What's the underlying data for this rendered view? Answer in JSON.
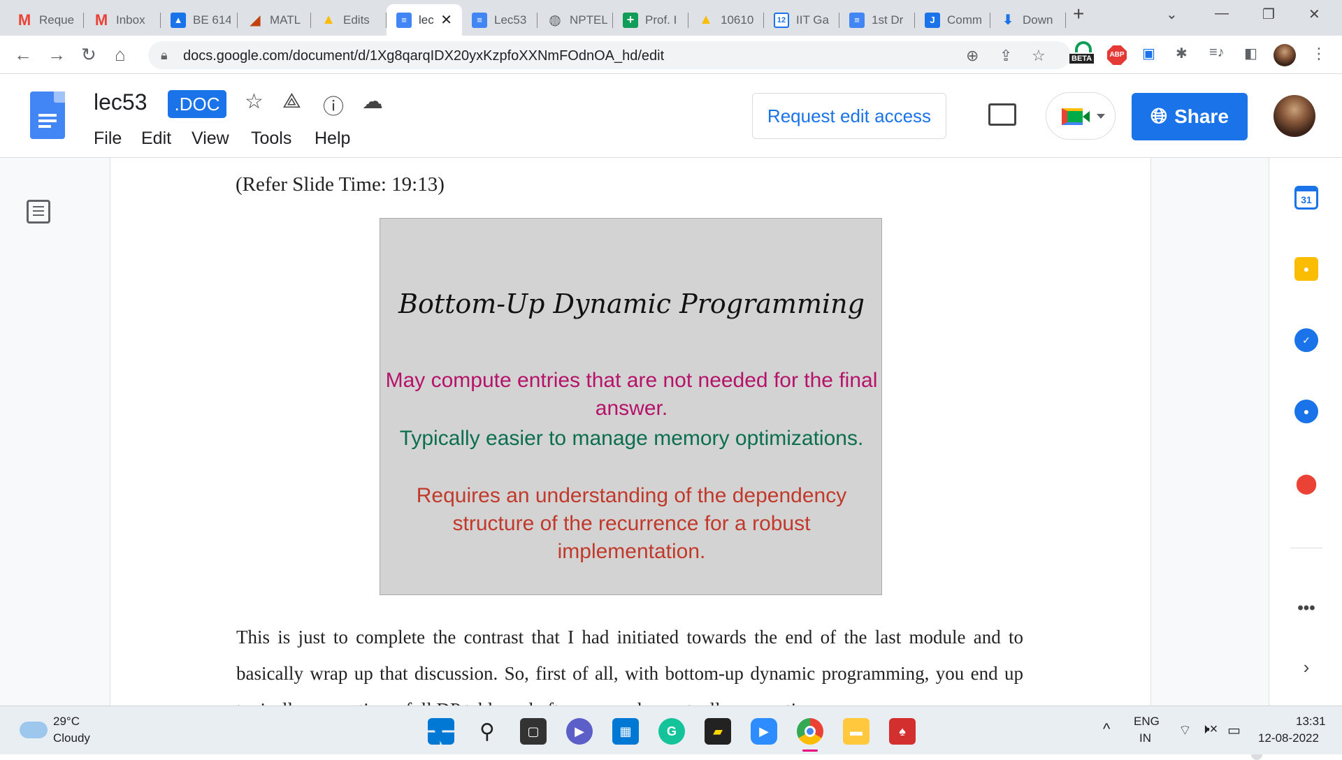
{
  "browser": {
    "tabs": [
      {
        "label": "Reque",
        "icon": "gmail-icon",
        "color": "#ea4335"
      },
      {
        "label": "Inbox",
        "icon": "gmail-icon",
        "color": "#ea4335"
      },
      {
        "label": "BE 614",
        "icon": "contacts-icon",
        "color": "#1a73e8"
      },
      {
        "label": "MATL",
        "icon": "matlab-icon",
        "color": "#c2410c"
      },
      {
        "label": "Edits",
        "icon": "drive-icon",
        "color": "#fbbc04"
      },
      {
        "label": "lec",
        "icon": "docs-icon",
        "color": "#4285f4",
        "active": true
      },
      {
        "label": "Lec53",
        "icon": "docs-icon",
        "color": "#4285f4"
      },
      {
        "label": "NPTEL",
        "icon": "globe-icon",
        "color": "#5f6368"
      },
      {
        "label": "Prof. I",
        "icon": "plus-sheet-icon",
        "color": "#0f9d58"
      },
      {
        "label": "10610",
        "icon": "drive-icon",
        "color": "#fbbc04"
      },
      {
        "label": "IIT Ga",
        "icon": "calendar-icon",
        "color": "#1a73e8"
      },
      {
        "label": "1st Dr",
        "icon": "docs-icon",
        "color": "#4285f4"
      },
      {
        "label": "Comm",
        "icon": "jamboard-icon",
        "color": "#1a73e8"
      },
      {
        "label": "Down",
        "icon": "download-icon",
        "color": "#1a73e8"
      }
    ],
    "url": "docs.google.com/document/d/1Xg8qarqIDX20yxKzpfoXXNmFOdnOA_hd/edit",
    "ext_beta": "BETA",
    "ext_abp": "ABP"
  },
  "doc": {
    "title": "lec53",
    "badge": ".DOC",
    "menu": [
      "File",
      "Edit",
      "View",
      "Tools",
      "Help"
    ],
    "request_access": "Request edit access",
    "share": "Share",
    "refer": "(Refer Slide Time: 19:13)",
    "slide": {
      "title": "Bottom-Up Dynamic Programming",
      "lines": [
        {
          "text": "May compute entries that are not needed for the final answer.",
          "color": "#b5126a"
        },
        {
          "text": "Typically easier to manage memory optimizations.",
          "color": "#0b6e4f"
        },
        {
          "text": "Requires an understanding of the dependency structure of the recurrence for a robust implementation.",
          "color": "#c0392b"
        }
      ]
    },
    "paragraph": "This is just to complete the contrast that I had initiated towards the end of the last module and to basically wrap up that discussion. So, first of all, with bottom-up dynamic programming, you end up typically computing a full DP table and often you end up actually computing"
  },
  "sidepanel": {
    "calendar_day": "31"
  },
  "taskbar": {
    "temp": "29°C",
    "condition": "Cloudy",
    "lang1": "ENG",
    "lang2": "IN",
    "time": "13:31",
    "date": "12-08-2022"
  }
}
